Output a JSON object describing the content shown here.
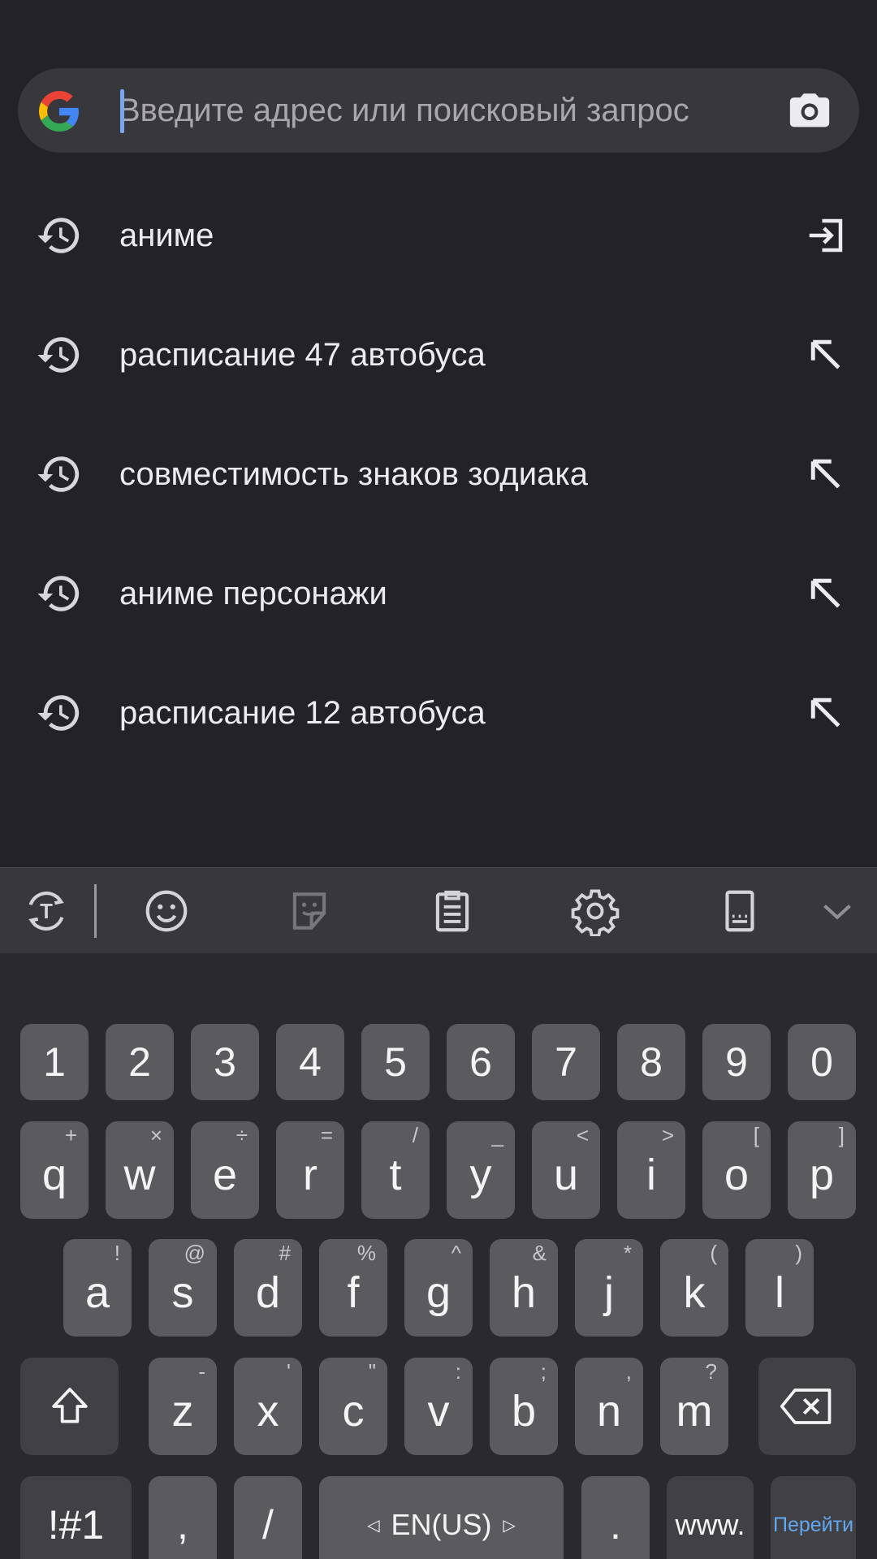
{
  "search": {
    "placeholder": "Введите адрес или поисковый запрос",
    "value": "",
    "engine_icon": "google-g-icon",
    "camera_icon": "camera-icon"
  },
  "suggestions": [
    {
      "text": "аниме",
      "action": "open-in-tab-icon"
    },
    {
      "text": "расписание 47 автобуса",
      "action": "arrow-up-left-icon"
    },
    {
      "text": "совместимость знаков зодиака",
      "action": "arrow-up-left-icon"
    },
    {
      "text": "аниме персонажи",
      "action": "arrow-up-left-icon"
    },
    {
      "text": "расписание 12 автобуса",
      "action": "arrow-up-left-icon"
    }
  ],
  "keyboard": {
    "toolbar": [
      "translate-icon",
      "emoji-icon",
      "sticker-icon",
      "clipboard-icon",
      "settings-icon",
      "keyboard-mode-icon",
      "chevron-down-icon"
    ],
    "numbers": [
      "1",
      "2",
      "3",
      "4",
      "5",
      "6",
      "7",
      "8",
      "9",
      "0"
    ],
    "row1": [
      {
        "k": "q",
        "h": "+"
      },
      {
        "k": "w",
        "h": "×"
      },
      {
        "k": "e",
        "h": "÷"
      },
      {
        "k": "r",
        "h": "="
      },
      {
        "k": "t",
        "h": "/"
      },
      {
        "k": "y",
        "h": "_"
      },
      {
        "k": "u",
        "h": "<"
      },
      {
        "k": "i",
        "h": ">"
      },
      {
        "k": "o",
        "h": "["
      },
      {
        "k": "p",
        "h": "]"
      }
    ],
    "row2": [
      {
        "k": "a",
        "h": "!"
      },
      {
        "k": "s",
        "h": "@"
      },
      {
        "k": "d",
        "h": "#"
      },
      {
        "k": "f",
        "h": "%"
      },
      {
        "k": "g",
        "h": "^"
      },
      {
        "k": "h",
        "h": "&"
      },
      {
        "k": "j",
        "h": "*"
      },
      {
        "k": "k",
        "h": "("
      },
      {
        "k": "l",
        "h": ")"
      }
    ],
    "row3": [
      {
        "k": "z",
        "h": "-"
      },
      {
        "k": "x",
        "h": "'"
      },
      {
        "k": "c",
        "h": "\""
      },
      {
        "k": "v",
        "h": ":"
      },
      {
        "k": "b",
        "h": ";"
      },
      {
        "k": "n",
        "h": ","
      },
      {
        "k": "m",
        "h": "?"
      }
    ],
    "symbols_label": "!#1",
    "comma": ",",
    "slash": "/",
    "language": "EN(US)",
    "period": ".",
    "www": "www.",
    "go": "Перейти"
  },
  "colors": {
    "background": "#232226",
    "search_bar": "#38373c",
    "key": "#5b5a5f",
    "go_text": "#62a8ee"
  }
}
